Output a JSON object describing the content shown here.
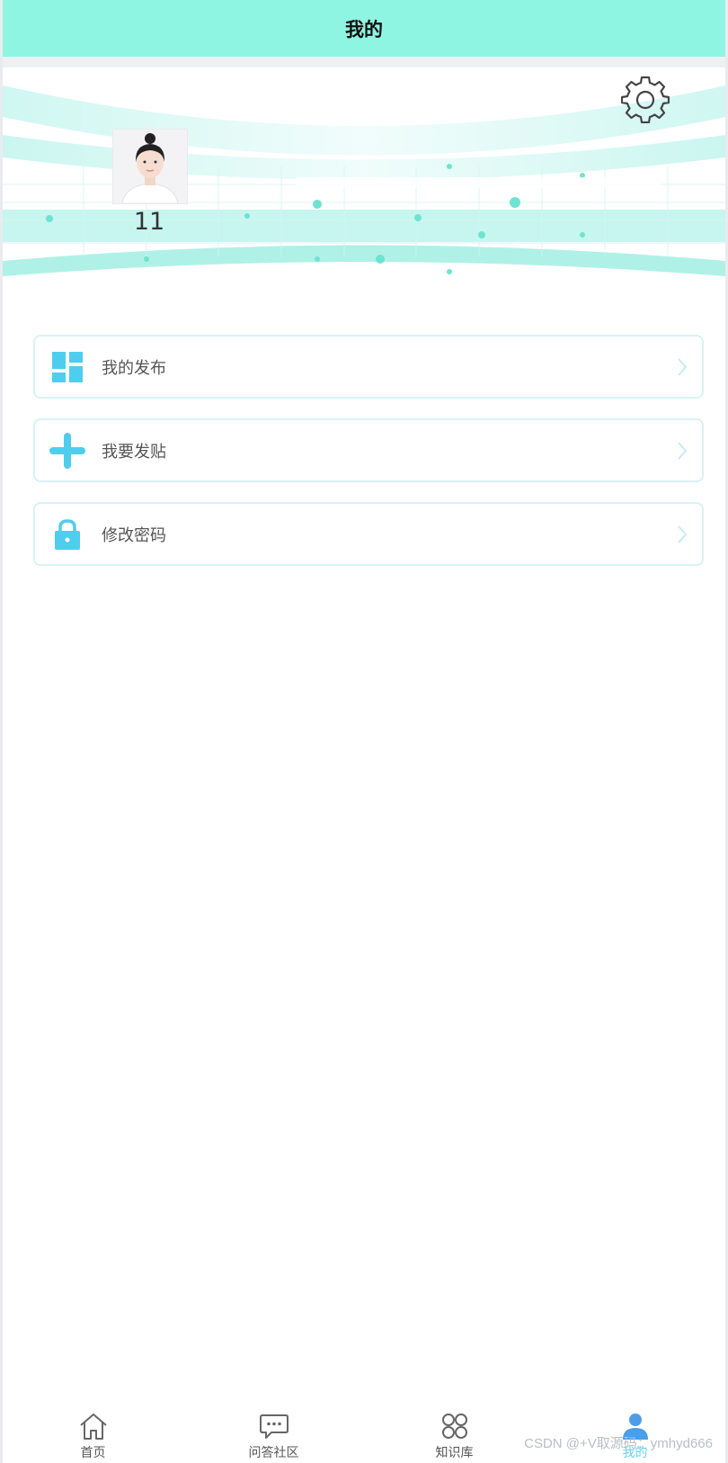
{
  "header": {
    "title": "我的"
  },
  "profile": {
    "username": "11",
    "avatar_icon": "avatar-photo",
    "settings_icon": "gear-icon"
  },
  "menu": {
    "items": [
      {
        "label": "我的发布",
        "icon": "grid-icon"
      },
      {
        "label": "我要发贴",
        "icon": "plus-icon"
      },
      {
        "label": "修改密码",
        "icon": "lock-icon"
      }
    ]
  },
  "tabbar": {
    "items": [
      {
        "label": "首页",
        "icon": "home-icon",
        "active": false
      },
      {
        "label": "问答社区",
        "icon": "chat-icon",
        "active": false
      },
      {
        "label": "知识库",
        "icon": "knowledge-icon",
        "active": false
      },
      {
        "label": "我的",
        "icon": "user-icon",
        "active": true
      }
    ]
  },
  "watermark": "CSDN @+V取源码：ymhyd666",
  "colors": {
    "header_bg": "#8ff5e3",
    "accent": "#5fd4f0",
    "menu_border": "#d8f2f5"
  }
}
